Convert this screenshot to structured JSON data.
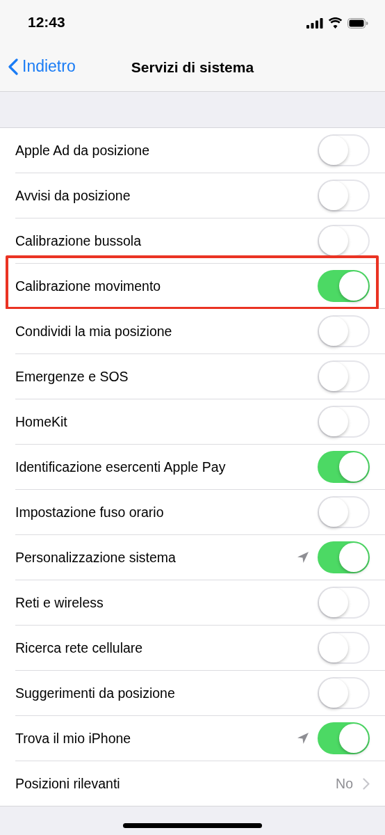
{
  "status_bar": {
    "time": "12:43"
  },
  "nav": {
    "back": "Indietro",
    "title": "Servizi di sistema"
  },
  "rows": [
    {
      "kind": "toggle",
      "label": "Apple Ad da posizione",
      "on": false,
      "location": false,
      "highlighted": false
    },
    {
      "kind": "toggle",
      "label": "Avvisi da posizione",
      "on": false,
      "location": false,
      "highlighted": false
    },
    {
      "kind": "toggle",
      "label": "Calibrazione bussola",
      "on": false,
      "location": false,
      "highlighted": false
    },
    {
      "kind": "toggle",
      "label": "Calibrazione movimento",
      "on": true,
      "location": false,
      "highlighted": true
    },
    {
      "kind": "toggle",
      "label": "Condividi la mia posizione",
      "on": false,
      "location": false,
      "highlighted": false
    },
    {
      "kind": "toggle",
      "label": "Emergenze e SOS",
      "on": false,
      "location": false,
      "highlighted": false
    },
    {
      "kind": "toggle",
      "label": "HomeKit",
      "on": false,
      "location": false,
      "highlighted": false
    },
    {
      "kind": "toggle",
      "label": "Identificazione esercenti Apple Pay",
      "on": true,
      "location": false,
      "highlighted": false
    },
    {
      "kind": "toggle",
      "label": "Impostazione fuso orario",
      "on": false,
      "location": false,
      "highlighted": false
    },
    {
      "kind": "toggle",
      "label": "Personalizzazione sistema",
      "on": true,
      "location": true,
      "highlighted": false
    },
    {
      "kind": "toggle",
      "label": "Reti e wireless",
      "on": false,
      "location": false,
      "highlighted": false
    },
    {
      "kind": "toggle",
      "label": "Ricerca rete cellulare",
      "on": false,
      "location": false,
      "highlighted": false
    },
    {
      "kind": "toggle",
      "label": "Suggerimenti da posizione",
      "on": false,
      "location": false,
      "highlighted": false
    },
    {
      "kind": "toggle",
      "label": "Trova il mio iPhone",
      "on": true,
      "location": true,
      "highlighted": false
    },
    {
      "kind": "link",
      "label": "Posizioni rilevanti",
      "value": "No"
    }
  ]
}
